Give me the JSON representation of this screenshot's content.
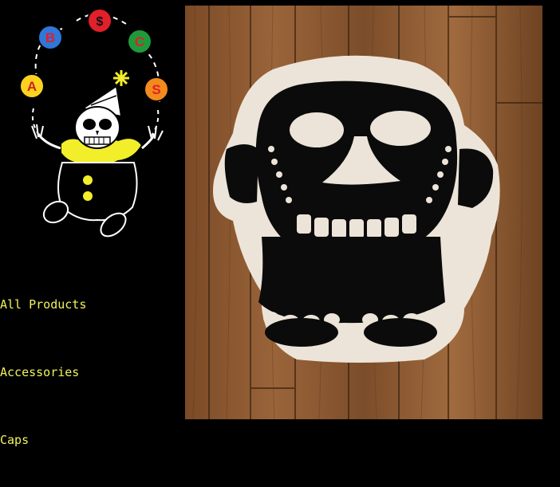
{
  "logo": {
    "juggling_balls": [
      {
        "letter": "A",
        "color": "#ffd21f"
      },
      {
        "letter": "B",
        "color": "#2f77d9"
      },
      {
        "letter": "$",
        "color": "#e0202a"
      },
      {
        "letter": "C",
        "color": "#1f9a3a"
      },
      {
        "letter": "S",
        "color": "#f28a1c"
      }
    ]
  },
  "nav": {
    "items": [
      {
        "label": "All Products"
      },
      {
        "label": "Accessories"
      },
      {
        "label": "Caps"
      }
    ]
  },
  "colors": {
    "background": "#000000",
    "link": "#f2f25c",
    "clown_collar": "#f2ee2a",
    "wood": "#8a5a32"
  }
}
